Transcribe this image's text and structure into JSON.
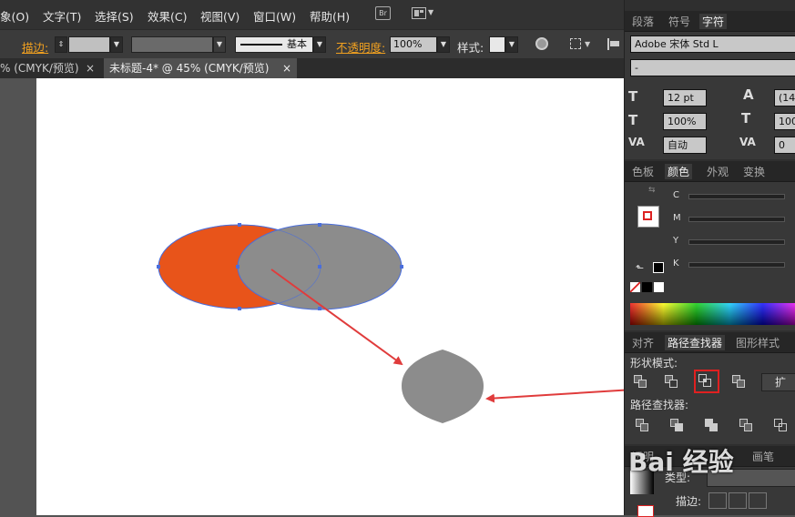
{
  "menubar": {
    "items": [
      "象(O)",
      "文字(T)",
      "选择(S)",
      "效果(C)",
      "视图(V)",
      "窗口(W)",
      "帮助(H)"
    ],
    "bridge_icon": "Br"
  },
  "options": {
    "stroke_label": "描边:",
    "stroke_style": "基本",
    "opacity_label": "不透明度:",
    "opacity_value": "100%",
    "style_label": "样式:"
  },
  "doc_tabs": [
    {
      "label": "% (CMYK/预览)",
      "close": "×"
    },
    {
      "label": "未标题-4* @ 45% (CMYK/预览)",
      "close": "×"
    }
  ],
  "char_panel": {
    "tabs": [
      "段落",
      "符号",
      "字符"
    ],
    "active_tab": "字符",
    "font_family": "Adobe 宋体 Std L",
    "font_style": "-",
    "font_size": "12 pt",
    "leading": "(14.",
    "vscale": "100%",
    "hscale": "100%",
    "kerning": "自动",
    "tracking": "0"
  },
  "color_panel": {
    "tabs": [
      "色板",
      "颜色",
      "外观",
      "变换"
    ],
    "active_tab": "颜色",
    "channels": [
      "C",
      "M",
      "Y",
      "K"
    ]
  },
  "pathfinder_panel": {
    "tabs": [
      "对齐",
      "路径查找器",
      "图形样式"
    ],
    "active_tab": "路径查找器",
    "shape_modes_label": "形状模式:",
    "pathfinders_label": "路径查找器:",
    "expand_label": "扩"
  },
  "bottom_panel": {
    "tabs": [
      "透明",
      "画笔"
    ],
    "type_label": "类型:",
    "stroke_label": "描边:"
  },
  "watermark": "Bai 经验",
  "colors": {
    "orange_ellipse": "#e8541a",
    "gray_ellipse": "#8c8c8c",
    "result_shape": "#8c8c8c",
    "arrow": "#e03c3c",
    "selection": "#4a6edc",
    "highlight_box": "#e02020"
  },
  "icons": [
    "bridge-icon",
    "arrange-icon",
    "recolor-icon",
    "align-icon"
  ]
}
